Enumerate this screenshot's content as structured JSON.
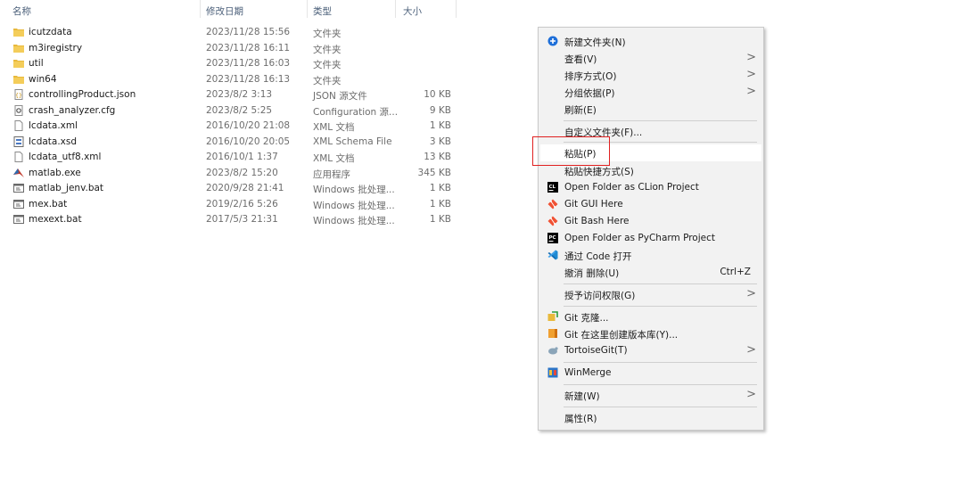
{
  "columns": {
    "name": "名称",
    "date": "修改日期",
    "type": "类型",
    "size": "大小",
    "sort_indicator": "^"
  },
  "files": [
    {
      "name": "icutzdata",
      "date": "2023/11/28 15:56",
      "type": "文件夹",
      "size": "",
      "icon": "folder-icon"
    },
    {
      "name": "m3iregistry",
      "date": "2023/11/28 16:11",
      "type": "文件夹",
      "size": "",
      "icon": "folder-icon"
    },
    {
      "name": "util",
      "date": "2023/11/28 16:03",
      "type": "文件夹",
      "size": "",
      "icon": "folder-icon"
    },
    {
      "name": "win64",
      "date": "2023/11/28 16:13",
      "type": "文件夹",
      "size": "",
      "icon": "folder-icon"
    },
    {
      "name": "controllingProduct.json",
      "date": "2023/8/2 3:13",
      "type": "JSON 源文件",
      "size": "10 KB",
      "icon": "json-file-icon"
    },
    {
      "name": "crash_analyzer.cfg",
      "date": "2023/8/2 5:25",
      "type": "Configuration 源...",
      "size": "9 KB",
      "icon": "config-file-icon"
    },
    {
      "name": "lcdata.xml",
      "date": "2016/10/20 21:08",
      "type": "XML 文档",
      "size": "1 KB",
      "icon": "document-icon"
    },
    {
      "name": "lcdata.xsd",
      "date": "2016/10/20 20:05",
      "type": "XML Schema File",
      "size": "3 KB",
      "icon": "schema-file-icon"
    },
    {
      "name": "lcdata_utf8.xml",
      "date": "2016/10/1 1:37",
      "type": "XML 文档",
      "size": "13 KB",
      "icon": "document-icon"
    },
    {
      "name": "matlab.exe",
      "date": "2023/8/2 15:20",
      "type": "应用程序",
      "size": "345 KB",
      "icon": "matlab-icon"
    },
    {
      "name": "matlab_jenv.bat",
      "date": "2020/9/28 21:41",
      "type": "Windows 批处理...",
      "size": "1 KB",
      "icon": "batch-file-icon"
    },
    {
      "name": "mex.bat",
      "date": "2019/2/16 5:26",
      "type": "Windows 批处理...",
      "size": "1 KB",
      "icon": "batch-file-icon"
    },
    {
      "name": "mexext.bat",
      "date": "2017/5/3 21:31",
      "type": "Windows 批处理...",
      "size": "1 KB",
      "icon": "batch-file-icon"
    }
  ],
  "context_menu": {
    "items": [
      {
        "label": "新建文件夹(N)",
        "icon": "new-folder-icon"
      },
      {
        "label": "查看(V)",
        "chevron": ">"
      },
      {
        "label": "排序方式(O)",
        "chevron": ">"
      },
      {
        "label": "分组依据(P)",
        "chevron": ">"
      },
      {
        "label": "刷新(E)"
      },
      {
        "label": "自定义文件夹(F)..."
      },
      {
        "label": "粘贴(P)"
      },
      {
        "label": "粘贴快捷方式(S)"
      },
      {
        "label": "Open Folder as CLion Project",
        "icon": "clion-icon"
      },
      {
        "label": "Git GUI Here",
        "icon": "git-icon"
      },
      {
        "label": "Git Bash Here",
        "icon": "git-icon"
      },
      {
        "label": "Open Folder as PyCharm Project",
        "icon": "pycharm-icon"
      },
      {
        "label": "通过 Code 打开",
        "icon": "vscode-icon"
      },
      {
        "label": "撤消 删除(U)",
        "shortcut": "Ctrl+Z"
      },
      {
        "label": "授予访问权限(G)",
        "chevron": ">"
      },
      {
        "label": "Git 克隆...",
        "icon": "tortoisegit-clone-icon"
      },
      {
        "label": "Git 在这里创建版本库(Y)...",
        "icon": "tortoisegit-create-icon"
      },
      {
        "label": "TortoiseGit(T)",
        "chevron": ">",
        "icon": "tortoisegit-icon"
      },
      {
        "label": "WinMerge",
        "icon": "winmerge-icon"
      },
      {
        "label": "新建(W)",
        "chevron": ">"
      },
      {
        "label": "属性(R)"
      }
    ]
  },
  "colors": {
    "folder": "#e8b93c",
    "highlight_box": "#e02020",
    "menu_bg": "#f2f2f2"
  }
}
